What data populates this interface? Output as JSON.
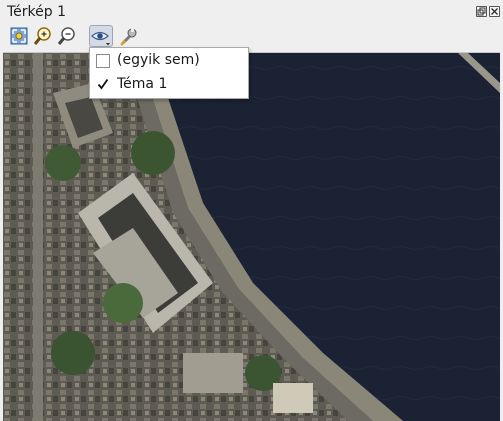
{
  "window": {
    "title": "Térkép 1",
    "restore_icon": "restore-icon",
    "close_icon": "close-icon"
  },
  "toolbar": {
    "tools": [
      {
        "name": "zoom-full-icon"
      },
      {
        "name": "zoom-in-icon"
      },
      {
        "name": "zoom-out-icon"
      },
      {
        "name": "theme-visibility-icon",
        "active": true
      },
      {
        "name": "settings-wrench-icon"
      }
    ]
  },
  "theme_menu": {
    "items": [
      {
        "label": "(egyik sem)",
        "checked": false
      },
      {
        "label": "Téma 1",
        "checked": true
      }
    ]
  },
  "map": {
    "kind": "aerial-satellite-imagery",
    "water_color": "#1b2233",
    "land_color": "#5b5a52"
  }
}
